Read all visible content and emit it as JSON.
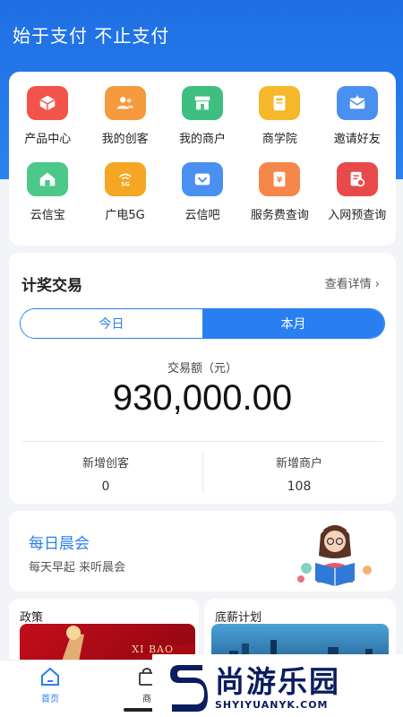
{
  "header": {
    "slogan": "始于支付 不止支付",
    "bg_color": "#2a7ff0"
  },
  "grid": {
    "items": [
      {
        "label": "产品中心",
        "icon": "box-icon",
        "color": "#f2544a"
      },
      {
        "label": "我的创客",
        "icon": "users-icon",
        "color": "#f59a3e"
      },
      {
        "label": "我的商户",
        "icon": "store-icon",
        "color": "#3fbf7f"
      },
      {
        "label": "商学院",
        "icon": "book-icon",
        "color": "#f5b82a"
      },
      {
        "label": "邀请好友",
        "icon": "envelope-icon",
        "color": "#4a90f0"
      },
      {
        "label": "云信宝",
        "icon": "home-shield-icon",
        "color": "#4cc98a"
      },
      {
        "label": "广电5G",
        "icon": "signal-5g-icon",
        "color": "#f5a623"
      },
      {
        "label": "云信吧",
        "icon": "chevron-box-icon",
        "color": "#4a90f0"
      },
      {
        "label": "服务费查询",
        "icon": "yen-doc-icon",
        "color": "#f5874a"
      },
      {
        "label": "入网预查询",
        "icon": "search-doc-icon",
        "color": "#e84a4a"
      }
    ]
  },
  "stats": {
    "title": "计奖交易",
    "more": "查看详情",
    "tabs": [
      "今日",
      "本月"
    ],
    "active_tab": "本月",
    "amount_label": "交易额（元）",
    "amount": "930,000.00",
    "new_makers_label": "新增创客",
    "new_makers": "0",
    "new_merchants_label": "新增商户",
    "new_merchants": "108"
  },
  "morning": {
    "title": "每日晨会",
    "subtitle": "每天早起 来听晨会"
  },
  "policy": {
    "title": "政策",
    "image_text": "XI BAO"
  },
  "salary": {
    "title": "底薪计划"
  },
  "tabbar": {
    "home": "首页",
    "shop": "商"
  },
  "watermark": {
    "cn": "尚游乐园",
    "en": "SHYIYUANYK.COM"
  }
}
